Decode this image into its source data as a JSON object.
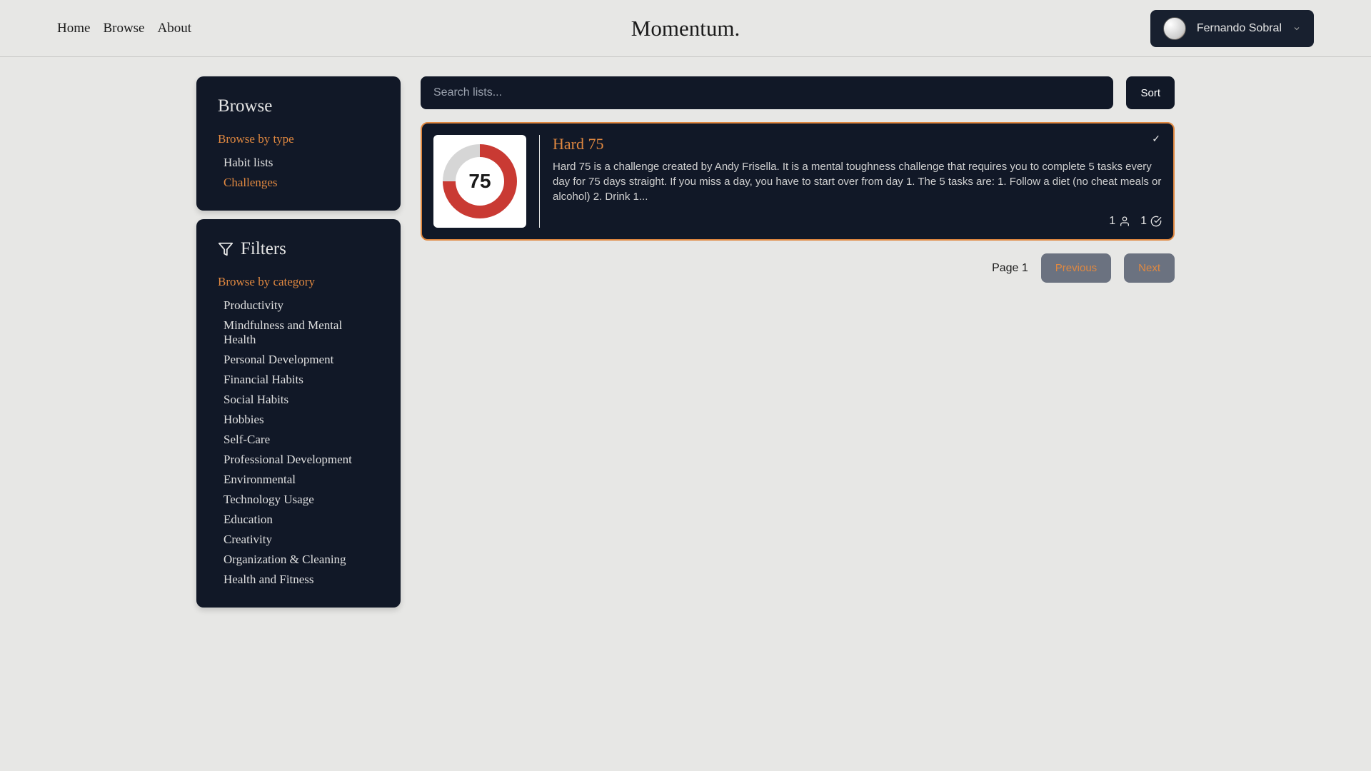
{
  "header": {
    "nav": {
      "home": "Home",
      "browse": "Browse",
      "about": "About"
    },
    "logo": "Momentum.",
    "user_name": "Fernando Sobral"
  },
  "sidebar": {
    "browse": {
      "title": "Browse",
      "section_label": "Browse by type",
      "types": [
        "Habit lists",
        "Challenges"
      ],
      "active_type": "Challenges"
    },
    "filters": {
      "title": "Filters",
      "section_label": "Browse by category",
      "categories": [
        "Productivity",
        "Mindfulness and Mental Health",
        "Personal Development",
        "Financial Habits",
        "Social Habits",
        "Hobbies",
        "Self-Care",
        "Professional Development",
        "Environmental",
        "Technology Usage",
        "Education",
        "Creativity",
        "Organization & Cleaning",
        "Health and Fitness"
      ]
    }
  },
  "search": {
    "placeholder": "Search lists...",
    "sort_label": "Sort"
  },
  "list_card": {
    "title": "Hard 75",
    "badge_text": "75",
    "description": "Hard 75 is a challenge created by Andy Frisella. It is a mental toughness challenge that requires you to complete 5 tasks every day for 75 days straight. If you miss a day, you have to start over from day 1. The 5 tasks are: 1. Follow a diet (no cheat meals or alcohol) 2. Drink 1...",
    "users_count": "1",
    "completed_count": "1"
  },
  "pagination": {
    "page_label": "Page 1",
    "prev": "Previous",
    "next": "Next"
  }
}
